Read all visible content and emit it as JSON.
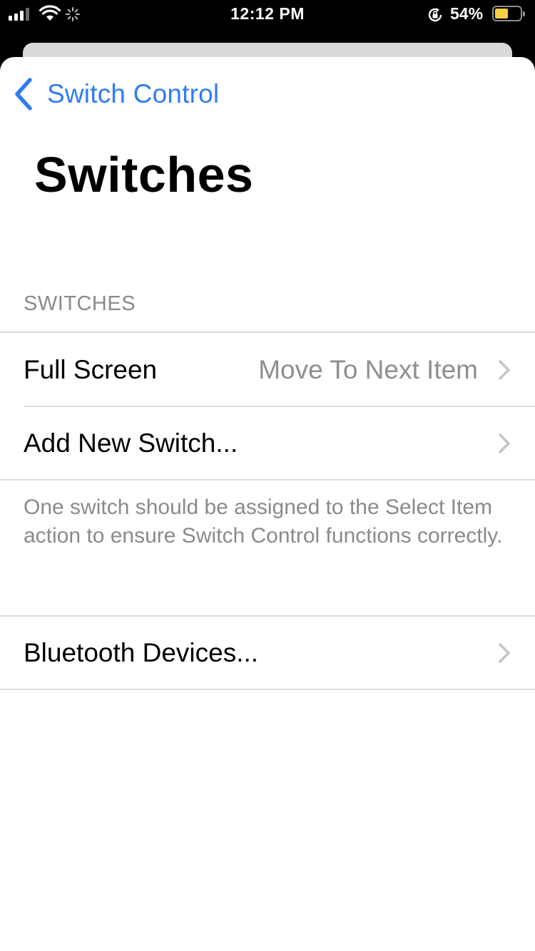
{
  "status_bar": {
    "time": "12:12 PM",
    "battery_percent": "54%",
    "battery_level": 0.54,
    "signal_bars_active": 3,
    "icons": [
      "signal-icon",
      "wifi-icon",
      "activity-spinner-icon",
      "orientation-lock-icon",
      "battery-icon"
    ]
  },
  "nav": {
    "back_label": "Switch Control"
  },
  "page": {
    "title": "Switches"
  },
  "section": {
    "header": "SWITCHES",
    "rows": [
      {
        "label": "Full Screen",
        "value": "Move To Next Item"
      },
      {
        "label": "Add New Switch...",
        "value": ""
      }
    ],
    "footer": "One switch should be assigned to the Select Item action to ensure Switch Control functions correctly."
  },
  "bluetooth_section": {
    "rows": [
      {
        "label": "Bluetooth Devices..."
      }
    ]
  },
  "colors": {
    "accent": "#2f7cf6",
    "secondary_text": "#8e8e93",
    "battery_fill": "#f7ce46"
  }
}
